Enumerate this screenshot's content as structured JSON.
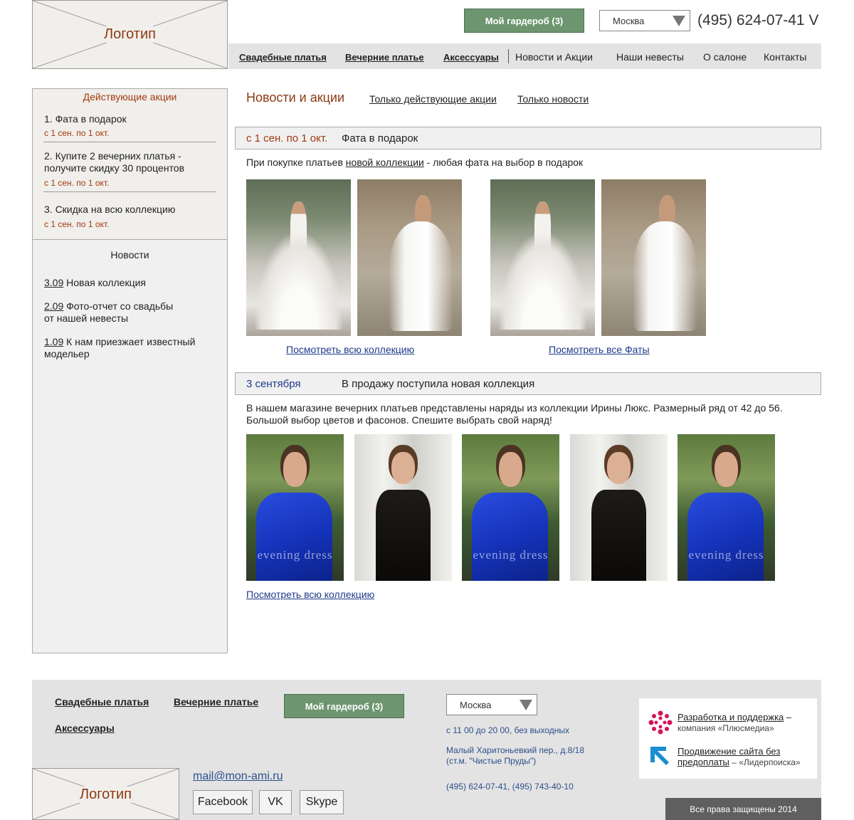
{
  "header": {
    "logo_text": "Логотип",
    "wardrobe_button": "Мой гардероб (3)",
    "city_select": "Москва",
    "phone": "(495) 624-07-41 V"
  },
  "nav": {
    "items": [
      "Свадебные платья",
      "Вечерние платье",
      "Аксессуары",
      "Новости и Акции",
      "Наши невесты",
      "О салоне",
      "Контакты"
    ]
  },
  "sidebar": {
    "promos_title": "Действующие акции",
    "promos": [
      {
        "title": "1. Фата в подарок",
        "dates": "с 1 сен. по 1 окт."
      },
      {
        "title_line1": "2. Купите 2 вечерних платья -",
        "title_line2": "получите скидку 30 процентов",
        "dates": "с 1 сен. по 1 окт."
      },
      {
        "title": "3. Скидка на всю коллекцию",
        "dates": "с 1 сен. по 1 окт."
      }
    ],
    "news_title": "Новости",
    "news": [
      {
        "date": "3.09",
        "text": "Новая коллекция"
      },
      {
        "date": "2.09",
        "text_line1": "Фото-отчет со свадьбы",
        "text_line2": "от нашей невесты"
      },
      {
        "date": "1.09",
        "text_line1": "К нам приезжает известный",
        "text_line2": "модельер"
      }
    ]
  },
  "main": {
    "title": "Новости и акции",
    "filter_promos": "Только действующие акции",
    "filter_news": "Только новости",
    "section1": {
      "date": "с 1 сен. по 1 окт.",
      "heading": "Фата в подарок",
      "text_before": "При покупке платьев ",
      "text_link": "новой коллекции",
      "text_after": " - любая фата на выбор в подарок",
      "link_collection": "Посмотреть всю коллекцию",
      "link_veils": "Посмотреть все Фаты"
    },
    "section2": {
      "date": "3 сентября",
      "heading": "В продажу поступила новая коллекция",
      "text_line1": "В нашем магазине вечерних платьев представлены наряды из коллекции Ирины Люкс. Размерный ряд от 42 до 56.",
      "text_line2": "Большой выбор цветов и фасонов. Спешите выбрать свой наряд!",
      "photo_watermark": "evening dress",
      "link_collection": "Посмотреть всю коллекцию"
    }
  },
  "footer": {
    "links": [
      "Свадебные платья",
      "Вечерние платье",
      "Аксессуары"
    ],
    "wardrobe_button": "Мой гардероб (3)",
    "city_select": "Москва",
    "hours": "с 11 00 до 20 00, без выходных",
    "address_line1": "Малый Харитоньевкий пер., д.8/18",
    "address_line2": "(ст.м. \"Чистые Пруды\")",
    "phones": "(495) 624-07-41, (495) 743-40-10",
    "logo_text": "Логотип",
    "email": "mail@mon-ami.ru",
    "social": [
      "Facebook",
      "VK",
      "Skype"
    ],
    "partner1_link": "Разработка и поддержка",
    "partner1_rest1": " –",
    "partner1_rest2": "компания «Плюсмедиа»",
    "partner2_link_line1": "Продвижение сайта без",
    "partner2_link_line2": "предоплаты",
    "partner2_rest": " – «Лидерпоиска»",
    "copyright": "Все права защищены 2014"
  },
  "colors": {
    "accent_green": "#6d956f",
    "promo_red": "#a23a0f",
    "link_blue": "#1f3a8a",
    "panel_gray": "#e3e3e3"
  }
}
